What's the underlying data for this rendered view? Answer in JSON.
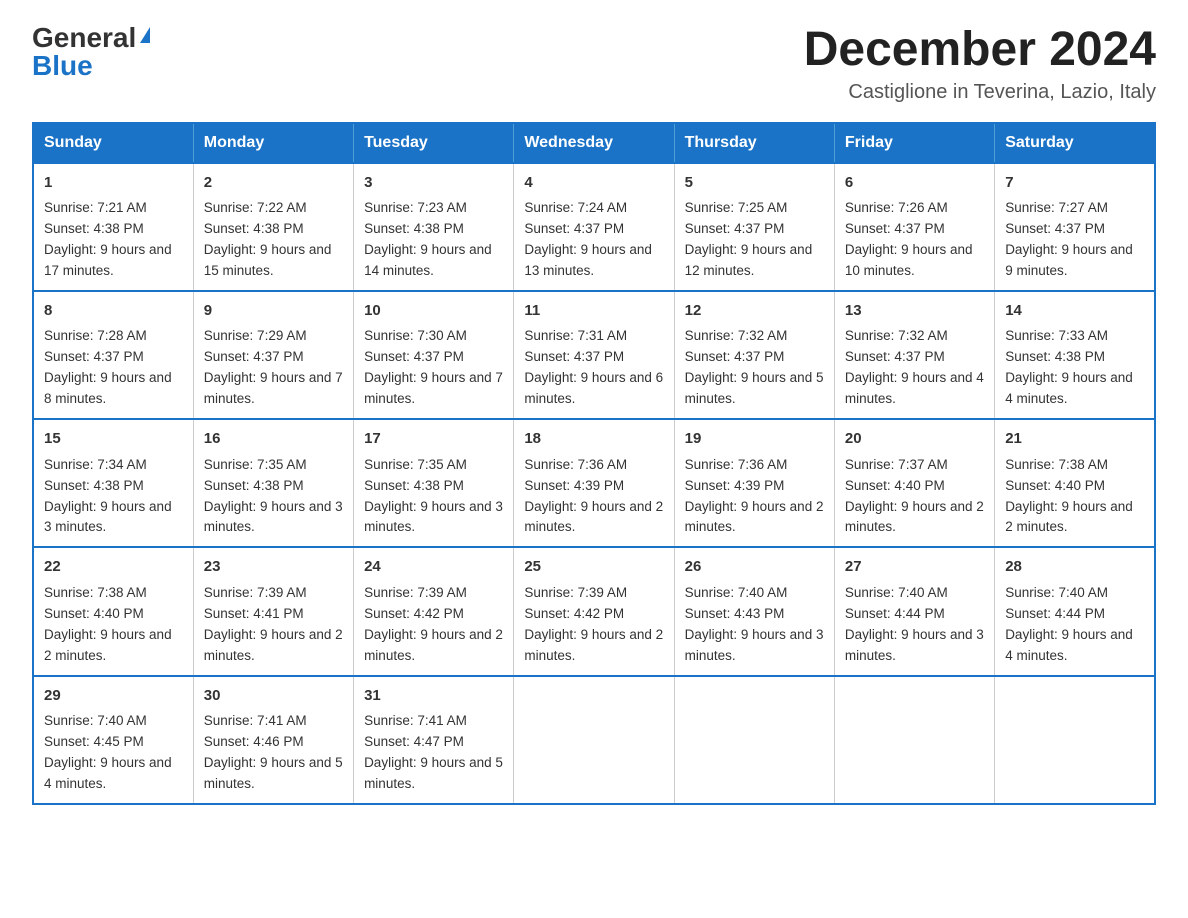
{
  "logo": {
    "general": "General",
    "blue": "Blue"
  },
  "header": {
    "month": "December 2024",
    "location": "Castiglione in Teverina, Lazio, Italy"
  },
  "days_of_week": [
    "Sunday",
    "Monday",
    "Tuesday",
    "Wednesday",
    "Thursday",
    "Friday",
    "Saturday"
  ],
  "weeks": [
    [
      {
        "day": "1",
        "sunrise": "7:21 AM",
        "sunset": "4:38 PM",
        "daylight": "9 hours and 17 minutes."
      },
      {
        "day": "2",
        "sunrise": "7:22 AM",
        "sunset": "4:38 PM",
        "daylight": "9 hours and 15 minutes."
      },
      {
        "day": "3",
        "sunrise": "7:23 AM",
        "sunset": "4:38 PM",
        "daylight": "9 hours and 14 minutes."
      },
      {
        "day": "4",
        "sunrise": "7:24 AM",
        "sunset": "4:37 PM",
        "daylight": "9 hours and 13 minutes."
      },
      {
        "day": "5",
        "sunrise": "7:25 AM",
        "sunset": "4:37 PM",
        "daylight": "9 hours and 12 minutes."
      },
      {
        "day": "6",
        "sunrise": "7:26 AM",
        "sunset": "4:37 PM",
        "daylight": "9 hours and 10 minutes."
      },
      {
        "day": "7",
        "sunrise": "7:27 AM",
        "sunset": "4:37 PM",
        "daylight": "9 hours and 9 minutes."
      }
    ],
    [
      {
        "day": "8",
        "sunrise": "7:28 AM",
        "sunset": "4:37 PM",
        "daylight": "9 hours and 8 minutes."
      },
      {
        "day": "9",
        "sunrise": "7:29 AM",
        "sunset": "4:37 PM",
        "daylight": "9 hours and 7 minutes."
      },
      {
        "day": "10",
        "sunrise": "7:30 AM",
        "sunset": "4:37 PM",
        "daylight": "9 hours and 7 minutes."
      },
      {
        "day": "11",
        "sunrise": "7:31 AM",
        "sunset": "4:37 PM",
        "daylight": "9 hours and 6 minutes."
      },
      {
        "day": "12",
        "sunrise": "7:32 AM",
        "sunset": "4:37 PM",
        "daylight": "9 hours and 5 minutes."
      },
      {
        "day": "13",
        "sunrise": "7:32 AM",
        "sunset": "4:37 PM",
        "daylight": "9 hours and 4 minutes."
      },
      {
        "day": "14",
        "sunrise": "7:33 AM",
        "sunset": "4:38 PM",
        "daylight": "9 hours and 4 minutes."
      }
    ],
    [
      {
        "day": "15",
        "sunrise": "7:34 AM",
        "sunset": "4:38 PM",
        "daylight": "9 hours and 3 minutes."
      },
      {
        "day": "16",
        "sunrise": "7:35 AM",
        "sunset": "4:38 PM",
        "daylight": "9 hours and 3 minutes."
      },
      {
        "day": "17",
        "sunrise": "7:35 AM",
        "sunset": "4:38 PM",
        "daylight": "9 hours and 3 minutes."
      },
      {
        "day": "18",
        "sunrise": "7:36 AM",
        "sunset": "4:39 PM",
        "daylight": "9 hours and 2 minutes."
      },
      {
        "day": "19",
        "sunrise": "7:36 AM",
        "sunset": "4:39 PM",
        "daylight": "9 hours and 2 minutes."
      },
      {
        "day": "20",
        "sunrise": "7:37 AM",
        "sunset": "4:40 PM",
        "daylight": "9 hours and 2 minutes."
      },
      {
        "day": "21",
        "sunrise": "7:38 AM",
        "sunset": "4:40 PM",
        "daylight": "9 hours and 2 minutes."
      }
    ],
    [
      {
        "day": "22",
        "sunrise": "7:38 AM",
        "sunset": "4:40 PM",
        "daylight": "9 hours and 2 minutes."
      },
      {
        "day": "23",
        "sunrise": "7:39 AM",
        "sunset": "4:41 PM",
        "daylight": "9 hours and 2 minutes."
      },
      {
        "day": "24",
        "sunrise": "7:39 AM",
        "sunset": "4:42 PM",
        "daylight": "9 hours and 2 minutes."
      },
      {
        "day": "25",
        "sunrise": "7:39 AM",
        "sunset": "4:42 PM",
        "daylight": "9 hours and 2 minutes."
      },
      {
        "day": "26",
        "sunrise": "7:40 AM",
        "sunset": "4:43 PM",
        "daylight": "9 hours and 3 minutes."
      },
      {
        "day": "27",
        "sunrise": "7:40 AM",
        "sunset": "4:44 PM",
        "daylight": "9 hours and 3 minutes."
      },
      {
        "day": "28",
        "sunrise": "7:40 AM",
        "sunset": "4:44 PM",
        "daylight": "9 hours and 4 minutes."
      }
    ],
    [
      {
        "day": "29",
        "sunrise": "7:40 AM",
        "sunset": "4:45 PM",
        "daylight": "9 hours and 4 minutes."
      },
      {
        "day": "30",
        "sunrise": "7:41 AM",
        "sunset": "4:46 PM",
        "daylight": "9 hours and 5 minutes."
      },
      {
        "day": "31",
        "sunrise": "7:41 AM",
        "sunset": "4:47 PM",
        "daylight": "9 hours and 5 minutes."
      },
      null,
      null,
      null,
      null
    ]
  ]
}
